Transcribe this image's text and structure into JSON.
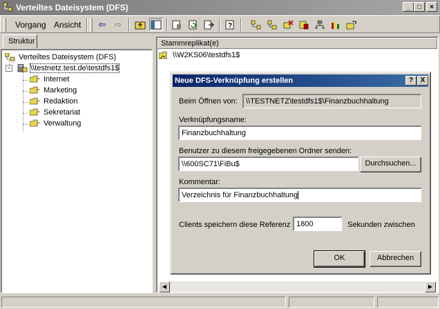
{
  "window": {
    "title": "Verteiltes Dateisystem (DFS)"
  },
  "menu": {
    "vorgang": "Vorgang",
    "ansicht": "Ansicht"
  },
  "left_pane": {
    "tab": "Struktur",
    "root": "Verteiltes Dateisystem (DFS)",
    "share": "\\\\testnetz.test.de\\testdfs1$",
    "children": [
      "Internet",
      "Marketing",
      "Redaktion",
      "Sekretariat",
      "Verwaltung"
    ]
  },
  "right_pane": {
    "column_header": "Stammreplikat(e)",
    "item": "\\\\W2KS06\\testdfs1$"
  },
  "dialog": {
    "title": "Neue DFS-Verknüpfung erstellen",
    "help_btn": "?",
    "close_btn": "X",
    "open_label": "Beim Öffnen von:",
    "open_value": "\\\\TESTNETZ\\testdfs1$\\Finanzbuchhaltung",
    "link_name_label": "Verknüpfungsname:",
    "link_name_value": "Finanzbuchhaltung",
    "send_label": "Benutzer zu diesem freigegebenen Ordner senden:",
    "send_value": "\\\\600SC71\\FiBu$",
    "browse_btn": "Durchsuchen...",
    "comment_label": "Kommentar:",
    "comment_value": "Verzeichnis für Finanzbuchhaltung",
    "cache_label": "Clients speichern diese Referenz",
    "cache_value": "1800",
    "cache_unit": "Sekunden zwischen",
    "ok": "OK",
    "cancel": "Abbrechen"
  },
  "colors": {
    "dialog_title_start": "#0a246a",
    "dialog_title_end": "#3a6ea5",
    "window_face": "#d4d0c8"
  }
}
